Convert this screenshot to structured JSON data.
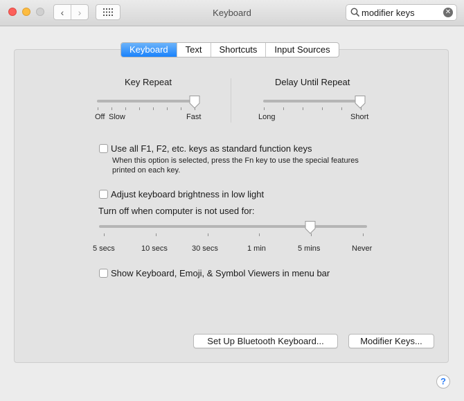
{
  "window": {
    "title": "Keyboard"
  },
  "search": {
    "value": "modifier keys",
    "placeholder": "Search"
  },
  "tabs": [
    "Keyboard",
    "Text",
    "Shortcuts",
    "Input Sources"
  ],
  "active_tab": "Keyboard",
  "key_repeat": {
    "title": "Key Repeat",
    "min_label": "Off",
    "left_label": "Slow",
    "right_label": "Fast",
    "value_fraction": 1.0
  },
  "delay_until_repeat": {
    "title": "Delay Until Repeat",
    "left_label": "Long",
    "right_label": "Short",
    "value_fraction": 1.0
  },
  "fn_keys": {
    "label": "Use all F1, F2, etc. keys as standard function keys",
    "checked": false,
    "description": "When this option is selected, press the Fn key to use the special features printed on each key."
  },
  "brightness": {
    "label": "Adjust keyboard brightness in low light",
    "checked": false
  },
  "turn_off": {
    "label": "Turn off when computer is not used for:",
    "ticks": [
      "5 secs",
      "10 secs",
      "30 secs",
      "1 min",
      "5 mins",
      "Never"
    ],
    "selected": "5 mins"
  },
  "viewers": {
    "label": "Show Keyboard, Emoji, & Symbol Viewers in menu bar",
    "checked": false
  },
  "buttons": {
    "bluetooth": "Set Up Bluetooth Keyboard...",
    "modifier": "Modifier Keys..."
  },
  "help": "?",
  "icons": {
    "back": "chevron-left-icon",
    "forward": "chevron-right-icon",
    "grid": "grid-icon",
    "search": "search-icon",
    "clear": "clear-icon"
  },
  "colors": {
    "accent": "#1a82fb",
    "close": "#fc605b",
    "minimize": "#fdbc40"
  }
}
